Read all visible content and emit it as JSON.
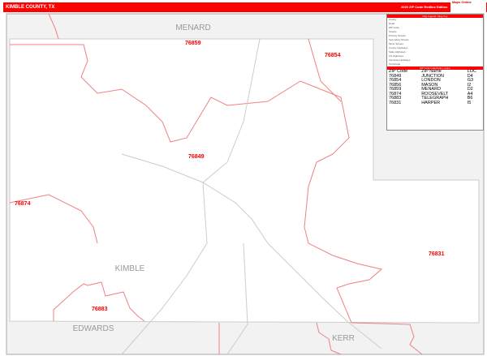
{
  "header": {
    "title": "KIMBLE COUNTY, TX",
    "edition": "2020 ZIP Code Redline Edition",
    "logo": "Maps Online"
  },
  "counties": {
    "main": "KIMBLE",
    "north": "MENARD",
    "south_west": "EDWARDS",
    "south_east": "KERR"
  },
  "zip_labels": [
    "76859",
    "76854",
    "76849",
    "76874",
    "76883",
    "76831"
  ],
  "legend": {
    "title": "Map Legend / Map Key",
    "items": [
      "County",
      "Road",
      "ZIP Code",
      "Streets",
      "Primary Streets",
      "Secondary Streets",
      "Minor Streets",
      "County Highways",
      "State Highways",
      "US Highways",
      "Interstate Highways",
      "Toll Roads"
    ],
    "zip_table_title": "ZIP Code Index/Grid Locator",
    "columns": [
      "ZIP Code",
      "ZIP Name",
      "LOC"
    ],
    "rows": [
      [
        "76849",
        "JUNCTION",
        "D4"
      ],
      [
        "76854",
        "LONDON",
        "G3"
      ],
      [
        "76856",
        "MASON",
        "I2"
      ],
      [
        "76859",
        "MENARD",
        "D2"
      ],
      [
        "76874",
        "ROOSEVELT",
        "A4"
      ],
      [
        "76883",
        "TELEGRAPH",
        "B6"
      ],
      [
        "76831",
        "HARPER",
        "I5"
      ]
    ]
  },
  "colors": {
    "accent": "#ff0000",
    "outside": "#f2f2f2",
    "zip_line": "#f08080"
  }
}
